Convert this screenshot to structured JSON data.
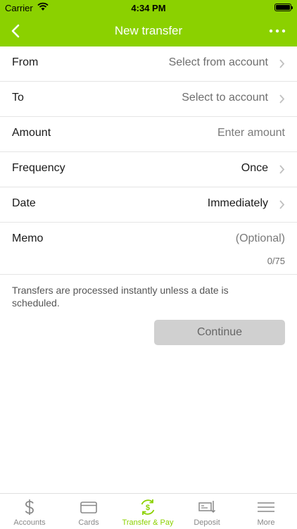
{
  "status": {
    "carrier": "Carrier",
    "time": "4:34 PM"
  },
  "nav": {
    "title": "New transfer"
  },
  "form": {
    "from": {
      "label": "From",
      "value": "Select from account"
    },
    "to": {
      "label": "To",
      "value": "Select to account"
    },
    "amount": {
      "label": "Amount",
      "placeholder": "Enter amount"
    },
    "frequency": {
      "label": "Frequency",
      "value": "Once"
    },
    "date": {
      "label": "Date",
      "value": "Immediately"
    },
    "memo": {
      "label": "Memo",
      "placeholder": "(Optional)",
      "counter": "0/75"
    }
  },
  "info_text": "Transfers are processed instantly unless a date is scheduled.",
  "continue_label": "Continue",
  "tabs": [
    {
      "label": "Accounts",
      "icon": "dollar-icon"
    },
    {
      "label": "Cards",
      "icon": "card-icon"
    },
    {
      "label": "Transfer & Pay",
      "icon": "transfer-icon",
      "active": true
    },
    {
      "label": "Deposit",
      "icon": "check-deposit-icon"
    },
    {
      "label": "More",
      "icon": "menu-icon"
    }
  ],
  "colors": {
    "brand": "#8bd100",
    "inactive_tab": "#888888",
    "button_disabled": "#d0d0d0"
  }
}
